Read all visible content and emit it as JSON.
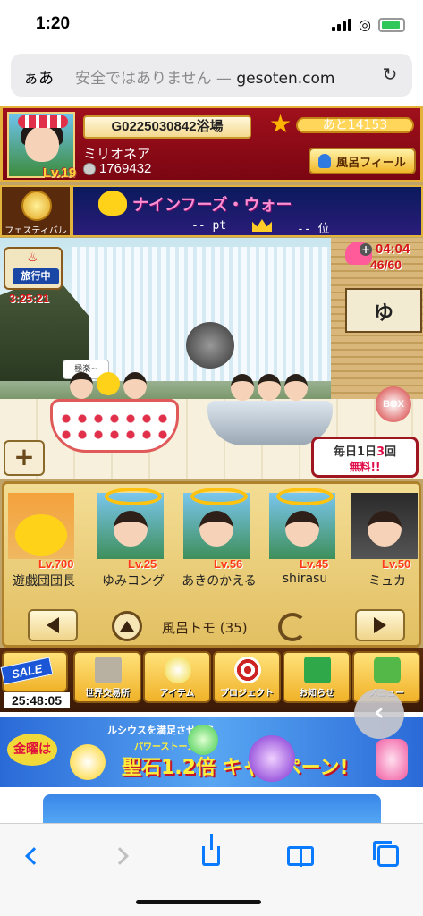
{
  "status_bar": {
    "time": "1:20"
  },
  "browser": {
    "aa_label": "ぁあ",
    "url_prefix": "安全ではありません — ",
    "url_domain": "gesoten.com"
  },
  "header": {
    "bath_id": "G0225030842浴場",
    "player_name": "ミリオネア",
    "coins": "1769432",
    "level": "Lv.19",
    "exp_text": "あと14153",
    "profile_button": "風呂フィール"
  },
  "festival": {
    "label": "フェスティバル",
    "banner_title": "ナインフーズ・ウォー",
    "points": "-- pt",
    "rank": "-- 位"
  },
  "scene": {
    "travel_label": "旅行中",
    "travel_timer": "3:25:21",
    "hp_timer": "04:04",
    "hp_count": "46/60",
    "noren_char": "ゆ",
    "speech_bubble": "極楽~",
    "gift_label": "BOX",
    "daily_line1_a": "毎日1日",
    "daily_line1_num": "3",
    "daily_line1_b": "回",
    "daily_line2": "無料!!"
  },
  "friends": {
    "items": [
      {
        "name": "遊戯団団長",
        "level": "Lv.700"
      },
      {
        "name": "ゆみコング",
        "level": "Lv.25"
      },
      {
        "name": "あきのかえる",
        "level": "Lv.56"
      },
      {
        "name": "shirasu",
        "level": "Lv.45"
      },
      {
        "name": "ミュカ",
        "level": "Lv.50"
      }
    ],
    "nav_label": "風呂トモ",
    "nav_count": "(35)"
  },
  "menu": {
    "sale_label": "SALE",
    "sale_timer": "25:48:05",
    "items": [
      {
        "label": "世界交易所"
      },
      {
        "label": "アイテム"
      },
      {
        "label": "プロジェクト"
      },
      {
        "label": "お知らせ"
      },
      {
        "label": "メニュー"
      }
    ]
  },
  "ad": {
    "kinyo": "金曜は",
    "top_text": "ルシウスを満足させたら",
    "sub_text": "パワーストーン",
    "main_text": "聖石1.2倍 キャンペーン!"
  },
  "colors": {
    "header_red": "#a0101c",
    "gold_border": "#e4b23a",
    "ios_blue": "#0a7aff"
  }
}
